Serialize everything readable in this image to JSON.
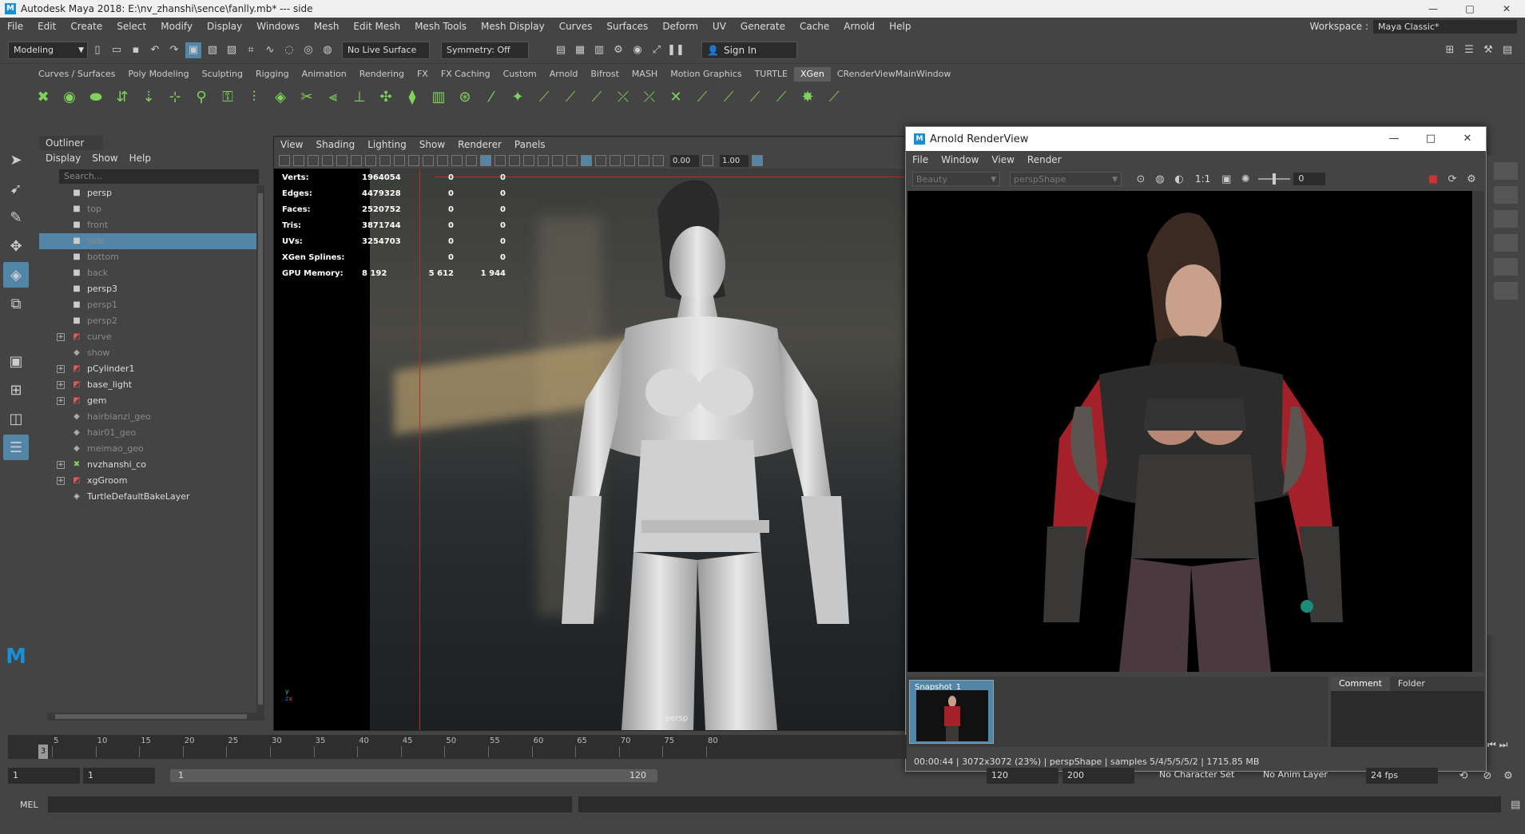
{
  "titlebar": {
    "title": "Autodesk Maya 2018: E:\\nv_zhanshi\\sence\\fanlly.mb*  ---  side",
    "minimize": "—",
    "maximize": "□",
    "close": "✕"
  },
  "menubar": {
    "items": [
      "File",
      "Edit",
      "Create",
      "Select",
      "Modify",
      "Display",
      "Windows",
      "Mesh",
      "Edit Mesh",
      "Mesh Tools",
      "Mesh Display",
      "Curves",
      "Surfaces",
      "Deform",
      "UV",
      "Generate",
      "Cache",
      "Arnold",
      "Help"
    ],
    "workspace_label": "Workspace :",
    "workspace_value": "Maya Classic*"
  },
  "statusline": {
    "mode": "Modeling",
    "live_surface": "No Live Surface",
    "symmetry": "Symmetry: Off",
    "signin": "Sign In"
  },
  "shelf": {
    "tabs": [
      "Curves / Surfaces",
      "Poly Modeling",
      "Sculpting",
      "Rigging",
      "Animation",
      "Rendering",
      "FX",
      "FX Caching",
      "Custom",
      "Arnold",
      "Bifrost",
      "MASH",
      "Motion Graphics",
      "TURTLE",
      "XGen",
      "CRenderViewMainWindow"
    ],
    "active_tab": "XGen"
  },
  "outliner": {
    "title": "Outliner",
    "menus": [
      "Display",
      "Show",
      "Help"
    ],
    "search_placeholder": "Search...",
    "items": [
      {
        "name": "persp",
        "type": "camera",
        "dim": false,
        "expandable": false,
        "selected": false
      },
      {
        "name": "top",
        "type": "camera",
        "dim": true,
        "expandable": false,
        "selected": false
      },
      {
        "name": "front",
        "type": "camera",
        "dim": true,
        "expandable": false,
        "selected": false
      },
      {
        "name": "side",
        "type": "camera",
        "dim": true,
        "expandable": false,
        "selected": true
      },
      {
        "name": "bottom",
        "type": "camera",
        "dim": true,
        "expandable": false,
        "selected": false
      },
      {
        "name": "back",
        "type": "camera",
        "dim": true,
        "expandable": false,
        "selected": false
      },
      {
        "name": "persp3",
        "type": "camera",
        "dim": false,
        "expandable": false,
        "selected": false
      },
      {
        "name": "persp1",
        "type": "camera",
        "dim": true,
        "expandable": false,
        "selected": false
      },
      {
        "name": "persp2",
        "type": "camera",
        "dim": true,
        "expandable": false,
        "selected": false
      },
      {
        "name": "curve",
        "type": "group",
        "dim": true,
        "expandable": true,
        "selected": false
      },
      {
        "name": "show",
        "type": "mesh",
        "dim": true,
        "expandable": false,
        "selected": false
      },
      {
        "name": "pCylinder1",
        "type": "group",
        "dim": false,
        "expandable": true,
        "selected": false
      },
      {
        "name": "base_light",
        "type": "group",
        "dim": false,
        "expandable": true,
        "selected": false
      },
      {
        "name": "gem",
        "type": "group",
        "dim": false,
        "expandable": true,
        "selected": false
      },
      {
        "name": "hairbianzi_geo",
        "type": "mesh",
        "dim": true,
        "expandable": false,
        "selected": false
      },
      {
        "name": "hair01_geo",
        "type": "mesh",
        "dim": true,
        "expandable": false,
        "selected": false
      },
      {
        "name": "meimao_geo",
        "type": "mesh",
        "dim": true,
        "expandable": false,
        "selected": false
      },
      {
        "name": "nvzhanshi_co",
        "type": "xgen",
        "dim": false,
        "expandable": true,
        "selected": false
      },
      {
        "name": "xgGroom",
        "type": "group",
        "dim": false,
        "expandable": true,
        "selected": false
      },
      {
        "name": "TurtleDefaultBakeLayer",
        "type": "layer",
        "dim": false,
        "expandable": false,
        "selected": false
      }
    ]
  },
  "viewport": {
    "menus": [
      "View",
      "Shading",
      "Lighting",
      "Show",
      "Renderer",
      "Panels"
    ],
    "field1": "0.00",
    "field2": "1.00",
    "camera_label": "persp",
    "stats": [
      {
        "label": "Verts:",
        "v": "1964054",
        "c1": "0",
        "c2": "0"
      },
      {
        "label": "Edges:",
        "v": "4479328",
        "c1": "0",
        "c2": "0"
      },
      {
        "label": "Faces:",
        "v": "2520752",
        "c1": "0",
        "c2": "0"
      },
      {
        "label": "Tris:",
        "v": "3871744",
        "c1": "0",
        "c2": "0"
      },
      {
        "label": "UVs:",
        "v": "3254703",
        "c1": "0",
        "c2": "0"
      },
      {
        "label": "XGen Splines:",
        "v": "",
        "c1": "0",
        "c2": "0"
      },
      {
        "label": "GPU Memory:",
        "v": "8 192",
        "c1": "5 612",
        "c2": "1 944"
      }
    ]
  },
  "arnold": {
    "title": "Arnold RenderView",
    "menus": [
      "File",
      "Window",
      "View",
      "Render"
    ],
    "aov": "Beauty",
    "camera": "perspShape",
    "ratio": "1:1",
    "exposure": "0",
    "snapshot_label": "Snapshot_1",
    "tabs": [
      "Comment",
      "Folder"
    ],
    "status": "00:00:44 | 3072x3072 (23%) | perspShape  | samples 5/4/5/5/5/2 | 1715.85 MB"
  },
  "timeslider": {
    "ticks": [
      "5",
      "10",
      "15",
      "20",
      "25",
      "30",
      "35",
      "40",
      "45",
      "50",
      "55",
      "60",
      "65",
      "70",
      "75",
      "80"
    ],
    "current": "3"
  },
  "range": {
    "start": "1",
    "start2": "1",
    "bar_start": "1",
    "bar_end": "120",
    "end": "120",
    "end2": "200",
    "character_set": "No Character Set",
    "anim_layer": "No Anim Layer",
    "fps": "24 fps"
  },
  "cmdline": {
    "label": "MEL"
  }
}
